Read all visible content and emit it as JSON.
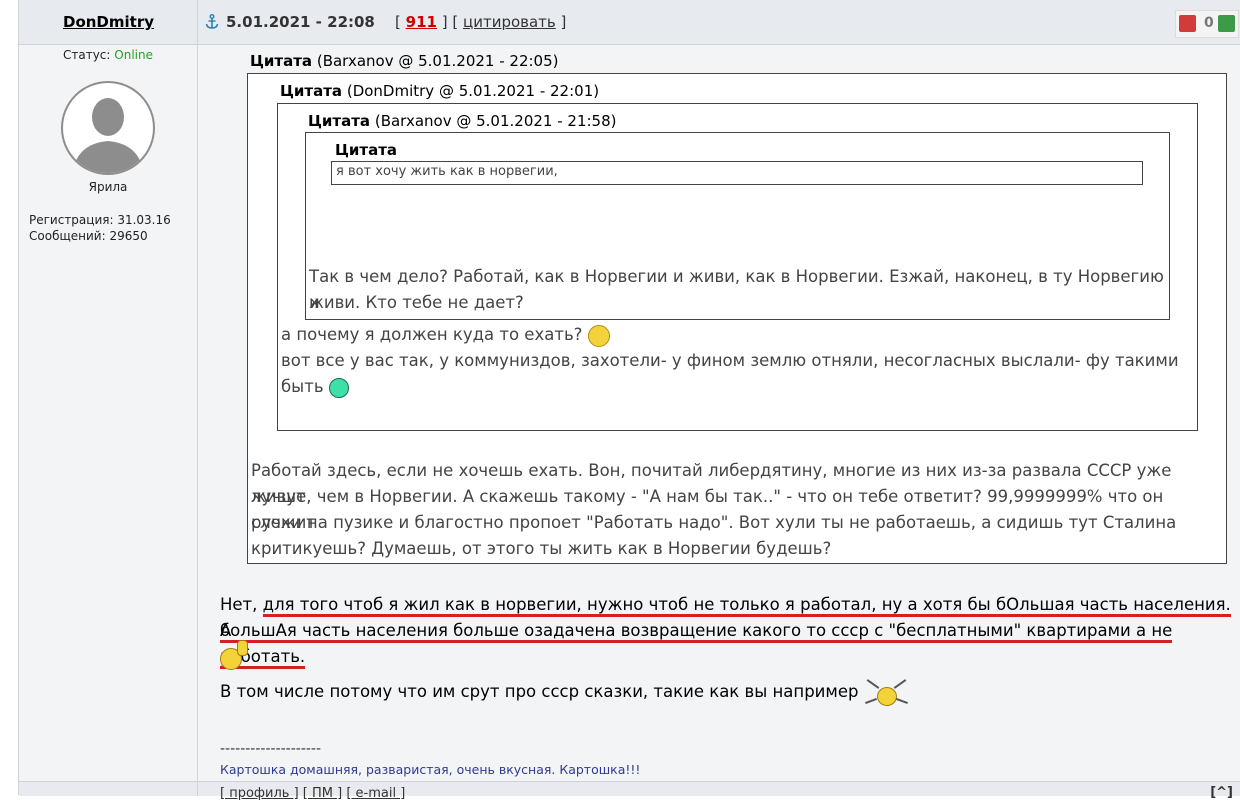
{
  "post": {
    "username": "DonDmitry",
    "date": "5.01.2021 - 22:08",
    "open_bracket": "[",
    "post_number": "911",
    "mid_bracket": "] [",
    "quote_label": "цитировать",
    "close_bracket": "]",
    "rating_value": "0"
  },
  "sidebar": {
    "status_label": "Статус:",
    "status_value": "Online",
    "rank": "Ярила",
    "reg_label": "Регистрация: 31.03.16",
    "posts_label": "Сообщений: 29650"
  },
  "quotes": {
    "q1_title": "Цитата",
    "q1_meta": "(Barxanov @ 5.01.2021 - 22:05)",
    "q2_title": "Цитата",
    "q2_meta": "(DonDmitry @ 5.01.2021 - 22:01)",
    "q3_title": "Цитата",
    "q3_meta": "(Barxanov @ 5.01.2021 - 21:58)",
    "q4_title": "Цитата",
    "q4_text": "я вот хочу жить как в норвегии,",
    "q3_text_1": "Так в чем дело? Работай, как в Норвегии и живи, как в Норвегии. Езжай, наконец, в ту Норвегию и",
    "q3_text_2": "живи. Кто тебе не дает?",
    "q2_text_1": "а почему я должен куда то ехать?",
    "q2_text_2": "вот все у вас так, у коммуниздов, захотели- у фином землю отняли, несогласных выслали- фу такими",
    "q2_text_3": "быть",
    "q1_text_1": "Работай здесь, если не хочешь ехать. Вон, почитай либердятину, многие из них из-за развала СССР уже живут",
    "q1_text_2": "лучше, чем в Норвегии. А скажешь такому - \"А нам бы так..\" - что он тебе ответит? 99,9999999% что он сложит",
    "q1_text_3": "ручки на пузике и благостно пропоет \"Работать надо\". Вот хули ты не работаешь, а сидишь тут Сталина",
    "q1_text_4": "критикуешь? Думаешь, от этого ты жить как в Норвегии будешь?"
  },
  "message": {
    "line1_prefix": "Нет,",
    "line1_underlined": "для того чтоб я жил как в норвегии, нужно чтоб не только я работал, ну а хотя бы бОльшая часть населения. А",
    "line2_underlined": "большАя часть населения больше озадачена возвращение какого то ссср с \"бесплатными\" квартирами а не работать.",
    "line3": "В том числе потому что им срут про ссср сказки, такие как вы например"
  },
  "signature": {
    "separator": "--------------------",
    "text": "Картошка домашняя, разваристая, очень вкусная. Картошка!!!"
  },
  "footer": {
    "profile": "[ профиль ]",
    "pm": "[ ПМ ]",
    "email": "[ e-mail ]",
    "top": "[^]"
  }
}
